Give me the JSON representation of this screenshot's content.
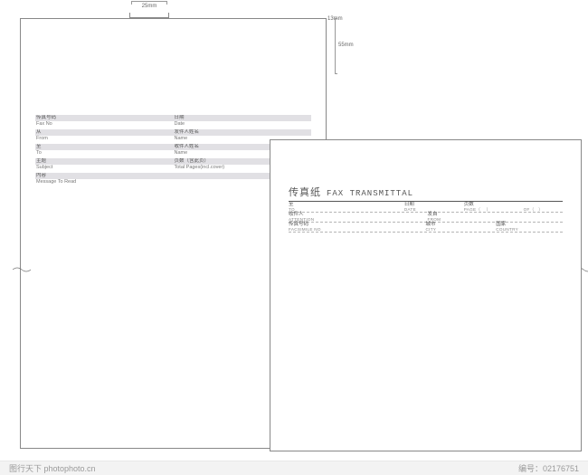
{
  "dims": {
    "w25": "25mm",
    "w13": "13mm",
    "h55": "55mm"
  },
  "page1": {
    "rows": [
      {
        "a_cn": "传真号码",
        "b_cn": "日期"
      },
      {
        "a_en": "Fax No",
        "b_en": "Date"
      },
      {
        "a_cn": "从",
        "b_cn": "发件人姓名"
      },
      {
        "a_en": "From",
        "b_en": "Name"
      },
      {
        "a_cn": "至",
        "b_cn": "收件人姓名"
      },
      {
        "a_en": "To",
        "b_en": "Name"
      },
      {
        "a_cn": "主题",
        "b_cn": "页数（含此页）"
      },
      {
        "a_en": "Subject",
        "b_en": "Total Pages(incl.cover)"
      },
      {
        "a_cn": "内容",
        "b_cn": ""
      },
      {
        "a_en": "Message To Read",
        "b_en": ""
      }
    ]
  },
  "page2": {
    "title_cn": "传真纸",
    "title_en": "FAX TRANSMITTAL",
    "r1": {
      "c1_cn": "至",
      "c1_en": "TO",
      "c2_cn": "日期",
      "c2_en": "DATE",
      "c3_cn": "页数",
      "c3_en": "PAGE（",
      "paren_close": "）",
      "of": "OF（",
      "of_close": "）"
    },
    "r2": {
      "c1_cn": "收件人",
      "c1_en": "ATTENTION",
      "c2_cn": "发自",
      "c2_en": "FROM"
    },
    "r3": {
      "c1_cn": "传真号码",
      "c1_en": "FACSIMILE NO",
      "c2_cn": "城市",
      "c2_en": "CITY",
      "c3_cn": "国家",
      "c3_en": "COUNTRY"
    }
  },
  "footer": {
    "left": "图行天下 photophoto.cn",
    "right_label": "编号：",
    "right_value": "02176751"
  }
}
